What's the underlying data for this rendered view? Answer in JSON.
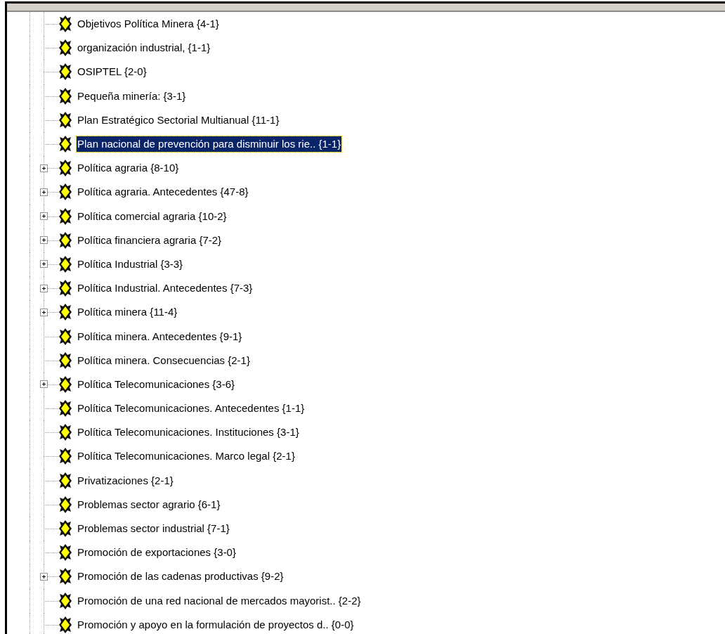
{
  "tree": {
    "items": [
      {
        "label": "Objetivos Política Minera {4-1}",
        "has_children": false,
        "selected": false
      },
      {
        "label": "organización industrial, {1-1}",
        "has_children": false,
        "selected": false
      },
      {
        "label": "OSIPTEL {2-0}",
        "has_children": false,
        "selected": false
      },
      {
        "label": "Pequeña minería: {3-1}",
        "has_children": false,
        "selected": false
      },
      {
        "label": "Plan Estratégico Sectorial Multianual {11-1}",
        "has_children": false,
        "selected": false
      },
      {
        "label": "Plan nacional de prevención para disminuir los rie.. {1-1}",
        "has_children": false,
        "selected": true
      },
      {
        "label": "Política agraria {8-10}",
        "has_children": true,
        "selected": false
      },
      {
        "label": "Política agraria. Antecedentes {47-8}",
        "has_children": true,
        "selected": false
      },
      {
        "label": "Política comercial agraria {10-2}",
        "has_children": true,
        "selected": false
      },
      {
        "label": "Política financiera agraria {7-2}",
        "has_children": true,
        "selected": false
      },
      {
        "label": "Política Industrial {3-3}",
        "has_children": true,
        "selected": false
      },
      {
        "label": "Política Industrial. Antecedentes {7-3}",
        "has_children": true,
        "selected": false
      },
      {
        "label": "Política minera {11-4}",
        "has_children": true,
        "selected": false
      },
      {
        "label": "Política minera. Antecedentes {9-1}",
        "has_children": false,
        "selected": false
      },
      {
        "label": "Política minera. Consecuencias {2-1}",
        "has_children": false,
        "selected": false
      },
      {
        "label": "Política Telecomunicaciones {3-6}",
        "has_children": true,
        "selected": false
      },
      {
        "label": "Política Telecomunicaciones. Antecedentes {1-1}",
        "has_children": false,
        "selected": false
      },
      {
        "label": "Política Telecomunicaciones. Instituciones {3-1}",
        "has_children": false,
        "selected": false
      },
      {
        "label": "Política Telecomunicaciones. Marco legal {2-1}",
        "has_children": false,
        "selected": false
      },
      {
        "label": "Privatizaciones {2-1}",
        "has_children": false,
        "selected": false
      },
      {
        "label": "Problemas sector agrario {6-1}",
        "has_children": false,
        "selected": false
      },
      {
        "label": "Problemas sector industrial {7-1}",
        "has_children": false,
        "selected": false
      },
      {
        "label": "Promoción de exportaciones {3-0}",
        "has_children": false,
        "selected": false
      },
      {
        "label": "Promoción de las cadenas productivas {9-2}",
        "has_children": true,
        "selected": false
      },
      {
        "label": "Promoción de una red nacional de mercados mayorist.. {2-2}",
        "has_children": false,
        "selected": false
      },
      {
        "label": "Promoción y apoyo en la formulación de proyectos d.. {0-0}",
        "has_children": false,
        "selected": false
      }
    ]
  }
}
